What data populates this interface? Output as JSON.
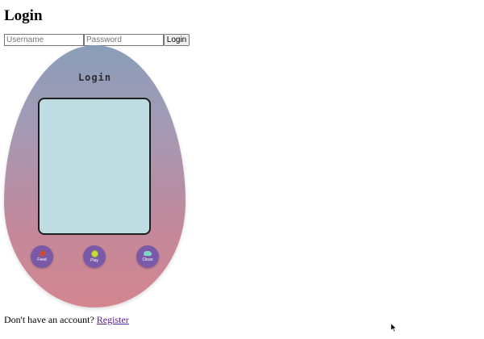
{
  "page": {
    "title": "Login"
  },
  "form": {
    "username_placeholder": "Username",
    "username_value": "",
    "password_placeholder": "Password",
    "password_value": "",
    "submit_label": "Login"
  },
  "device": {
    "title": "Login",
    "buttons": [
      {
        "label": "Feed",
        "icon": "food-icon"
      },
      {
        "label": "Play",
        "icon": "ball-icon"
      },
      {
        "label": "Clean",
        "icon": "soap-icon"
      }
    ],
    "colors": {
      "shell_top": "#8a9eb9",
      "shell_bottom": "#d48690",
      "screen": "#bfdde3",
      "button": "#7a5aa8"
    }
  },
  "footer": {
    "prompt": "Don't have an account?",
    "link_label": "Register"
  }
}
